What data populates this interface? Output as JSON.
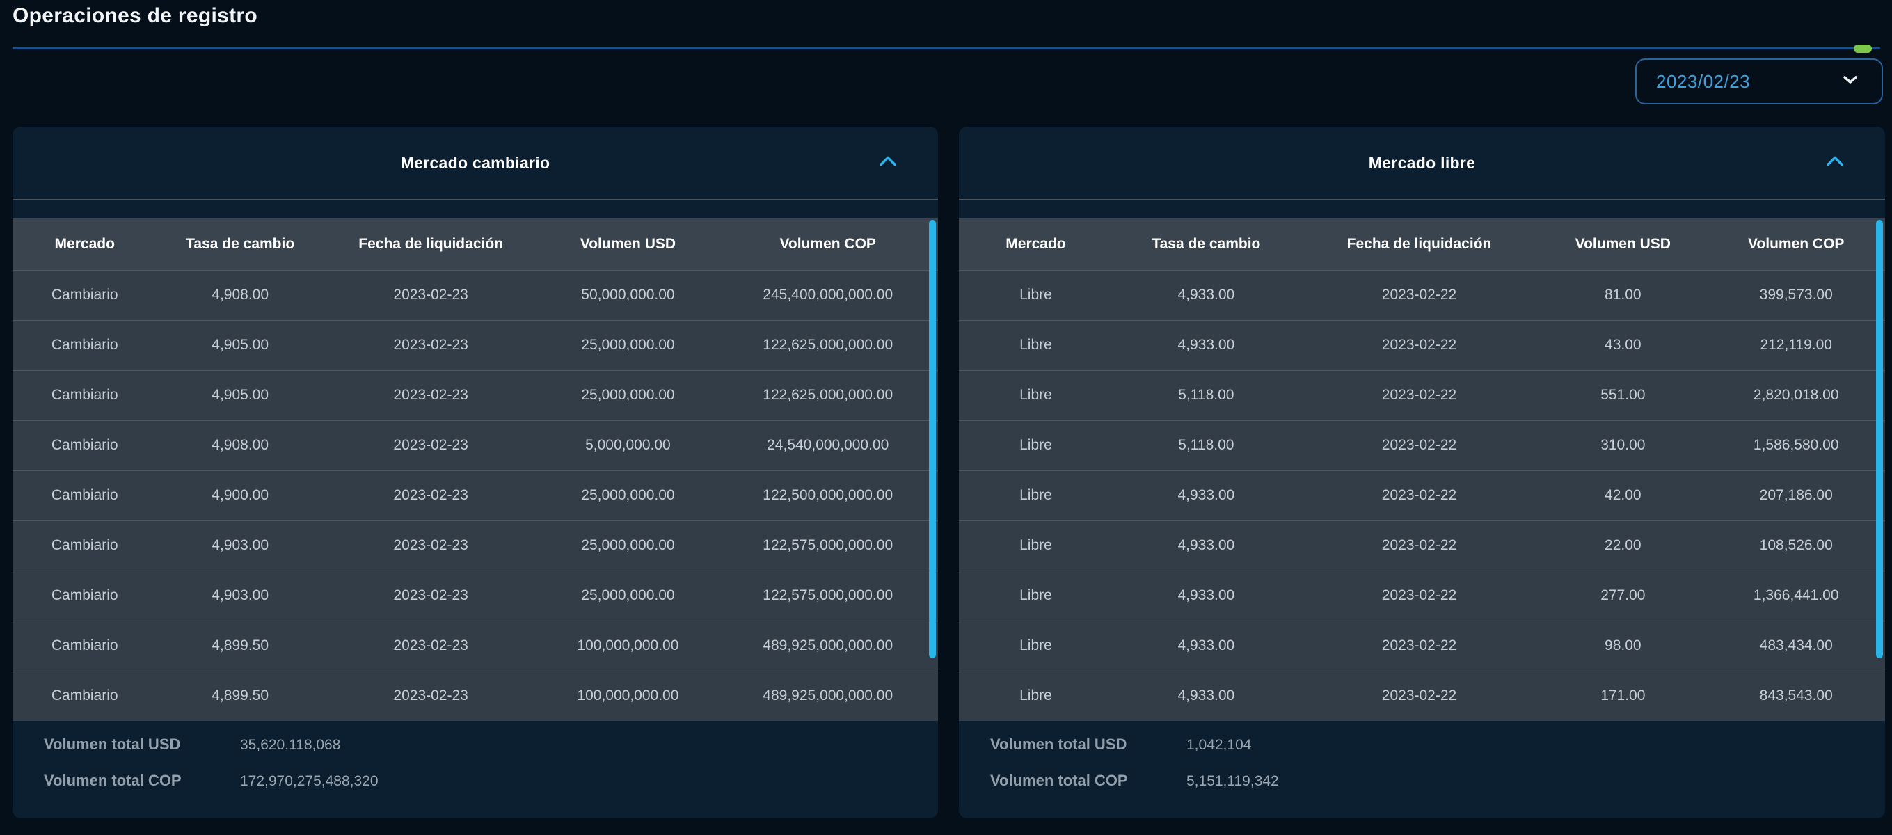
{
  "page": {
    "title": "Operaciones de registro"
  },
  "date_filter": {
    "value": "2023/02/23"
  },
  "panels": [
    {
      "title": "Mercado cambiario",
      "columns": [
        "Mercado",
        "Tasa de cambio",
        "Fecha de liquidación",
        "Volumen USD",
        "Volumen COP"
      ],
      "rows": [
        [
          "Cambiario",
          "4,908.00",
          "2023-02-23",
          "50,000,000.00",
          "245,400,000,000.00"
        ],
        [
          "Cambiario",
          "4,905.00",
          "2023-02-23",
          "25,000,000.00",
          "122,625,000,000.00"
        ],
        [
          "Cambiario",
          "4,905.00",
          "2023-02-23",
          "25,000,000.00",
          "122,625,000,000.00"
        ],
        [
          "Cambiario",
          "4,908.00",
          "2023-02-23",
          "5,000,000.00",
          "24,540,000,000.00"
        ],
        [
          "Cambiario",
          "4,900.00",
          "2023-02-23",
          "25,000,000.00",
          "122,500,000,000.00"
        ],
        [
          "Cambiario",
          "4,903.00",
          "2023-02-23",
          "25,000,000.00",
          "122,575,000,000.00"
        ],
        [
          "Cambiario",
          "4,903.00",
          "2023-02-23",
          "25,000,000.00",
          "122,575,000,000.00"
        ],
        [
          "Cambiario",
          "4,899.50",
          "2023-02-23",
          "100,000,000.00",
          "489,925,000,000.00"
        ],
        [
          "Cambiario",
          "4,899.50",
          "2023-02-23",
          "100,000,000.00",
          "489,925,000,000.00"
        ]
      ],
      "totals": {
        "usd_label": "Volumen total USD",
        "usd_value": "35,620,118,068",
        "cop_label": "Volumen total COP",
        "cop_value": "172,970,275,488,320"
      }
    },
    {
      "title": "Mercado libre",
      "columns": [
        "Mercado",
        "Tasa de cambio",
        "Fecha de liquidación",
        "Volumen USD",
        "Volumen COP"
      ],
      "rows": [
        [
          "Libre",
          "4,933.00",
          "2023-02-22",
          "81.00",
          "399,573.00"
        ],
        [
          "Libre",
          "4,933.00",
          "2023-02-22",
          "43.00",
          "212,119.00"
        ],
        [
          "Libre",
          "5,118.00",
          "2023-02-22",
          "551.00",
          "2,820,018.00"
        ],
        [
          "Libre",
          "5,118.00",
          "2023-02-22",
          "310.00",
          "1,586,580.00"
        ],
        [
          "Libre",
          "4,933.00",
          "2023-02-22",
          "42.00",
          "207,186.00"
        ],
        [
          "Libre",
          "4,933.00",
          "2023-02-22",
          "22.00",
          "108,526.00"
        ],
        [
          "Libre",
          "4,933.00",
          "2023-02-22",
          "277.00",
          "1,366,441.00"
        ],
        [
          "Libre",
          "4,933.00",
          "2023-02-22",
          "98.00",
          "483,434.00"
        ],
        [
          "Libre",
          "4,933.00",
          "2023-02-22",
          "171.00",
          "843,543.00"
        ]
      ],
      "totals": {
        "usd_label": "Volumen total USD",
        "usd_value": "1,042,104",
        "cop_label": "Volumen total COP",
        "cop_value": "5,151,119,342"
      }
    }
  ],
  "colors": {
    "accent_cyan": "#29b4ea",
    "date_text": "#419fd9",
    "green_indicator": "#7dc94e",
    "header_rule_blue": "#1b4f87",
    "card_bg": "#0c1f30",
    "table_header_bg": "#3a444e",
    "table_row_bg": "#333d47",
    "page_bg": "#050f19"
  }
}
